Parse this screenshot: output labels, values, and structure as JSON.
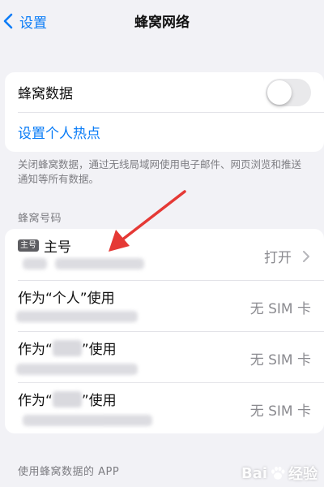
{
  "nav": {
    "back_label": "设置",
    "title": "蜂窝网络"
  },
  "cellular": {
    "data_label": "蜂窝数据",
    "data_enabled": false,
    "hotspot_label": "设置个人热点",
    "footnote": "关闭蜂窝数据，通过无线局域网使用电子邮件、网页浏览和推送通知等所有数据。"
  },
  "numbers": {
    "section_header": "蜂窝号码",
    "items": [
      {
        "badge": "主号",
        "title": "主号",
        "value": "打开",
        "has_chevron": true
      },
      {
        "title": "作为“个人”使用",
        "value": "无 SIM 卡"
      },
      {
        "title_prefix": "作为“",
        "title_suffix": "”使用",
        "value": "无 SIM 卡"
      },
      {
        "title_prefix": "作为“",
        "title_suffix": "”使用",
        "value": "无 SIM 卡"
      }
    ]
  },
  "apps": {
    "section_header": "使用蜂窝数据的 APP"
  },
  "watermark": {
    "text_left": "Bai",
    "text_right": "经验"
  },
  "colors": {
    "accent": "#0a7cf7",
    "background": "#f2f2f6",
    "annotation_arrow": "#e53935"
  }
}
